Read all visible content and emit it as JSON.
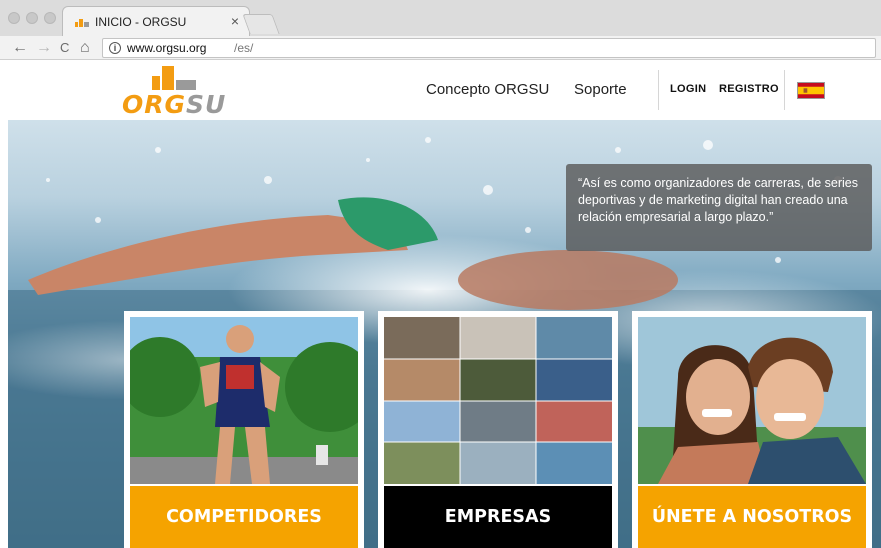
{
  "browser": {
    "tab_title": "INICIO - ORGSU",
    "tab_close": "×",
    "back": "←",
    "forward": "→",
    "reload": "C",
    "home": "⌂",
    "info": "i",
    "url_host": "www.orgsu.org",
    "url_path": "/es/"
  },
  "header": {
    "logo_text_orange": "ORG",
    "logo_text_gray": "SU",
    "nav": {
      "concepto": "Concepto ORGSU",
      "soporte": "Soporte",
      "login": "LOGIN",
      "registro": "REGISTRO"
    },
    "flag": "spain-flag-icon"
  },
  "hero": {
    "quote": "“Así es como organizadores de carreras, de series deportivas y de marketing digital han creado una relación empresarial a largo plazo.”"
  },
  "cards": [
    {
      "label": "COMPETIDORES",
      "color": "#f5a300"
    },
    {
      "label": "EMPRESAS",
      "color": "#000000"
    },
    {
      "label": "ÚNETE A NOSOTROS",
      "color": "#f5a300"
    }
  ],
  "colors": {
    "brand_orange": "#f39c12",
    "brand_gray": "#9a9a9a"
  }
}
